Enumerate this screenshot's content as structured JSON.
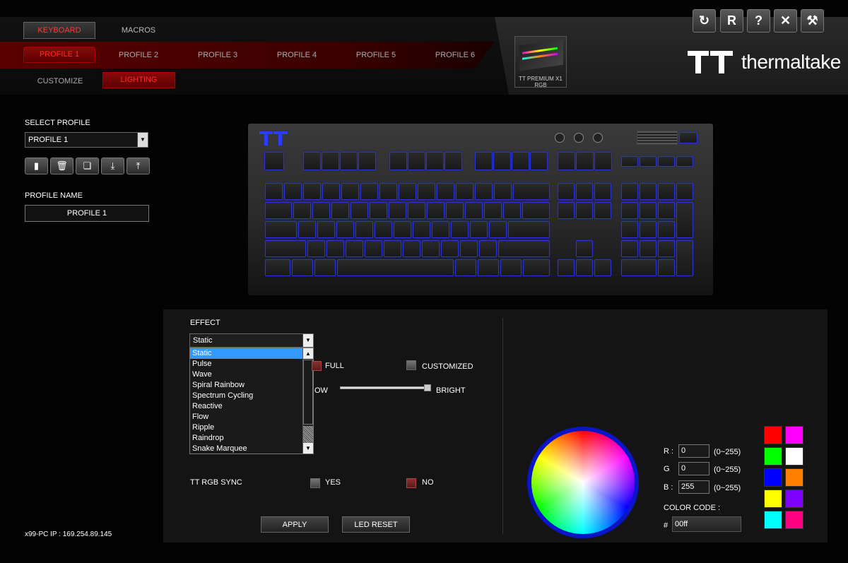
{
  "nav": {
    "keyboard_tab": "KEYBOARD",
    "macros_tab": "MACROS"
  },
  "profiles": [
    "PROFILE 1",
    "PROFILE 2",
    "PROFILE 3",
    "PROFILE 4",
    "PROFILE 5",
    "PROFILE 6"
  ],
  "subtabs": {
    "customize": "CUSTOMIZE",
    "lighting": "LIGHTING"
  },
  "device": {
    "name": "TT PREMIUM X1 RGB"
  },
  "brand": {
    "name": "thermaltake"
  },
  "toolbar": {
    "refresh_icon": "refresh-icon",
    "reset_label": "R",
    "help_label": "?",
    "close_label": "✕",
    "settings_icon": "wrench-icon"
  },
  "sidebar": {
    "select_profile_label": "SELECT PROFILE",
    "selected_profile": "PROFILE 1",
    "profile_name_label": "PROFILE NAME",
    "profile_name_value": "PROFILE 1",
    "ip_text": "x99-PC IP : 169.254.89.145"
  },
  "effect": {
    "label": "EFFECT",
    "selected": "Static",
    "options": [
      "Static",
      "Pulse",
      "Wave",
      "Spiral Rainbow",
      "Spectrum Cycling",
      "Reactive",
      "Flow",
      "Ripple",
      "Raindrop",
      "Snake Marquee"
    ],
    "full_label": "FULL",
    "customized_label": "CUSTOMIZED",
    "low_label": "OW",
    "bright_label": "BRIGHT",
    "brightness_level": 1.0
  },
  "sync": {
    "label": "TT RGB SYNC",
    "yes_label": "YES",
    "no_label": "NO"
  },
  "actions": {
    "apply": "APPLY",
    "led_reset": "LED RESET"
  },
  "color": {
    "r_label": "R :",
    "g_label": "G",
    "b_label": "B :",
    "r": "0",
    "g": "0",
    "b": "255",
    "range": "(0~255)",
    "code_label": "COLOR CODE :",
    "hash": "#",
    "code": "00ff",
    "swatches": [
      "#ff0000",
      "#ff00ff",
      "#00ff00",
      "#ffffff",
      "#0000ff",
      "#ff8000",
      "#ffff00",
      "#8000ff",
      "#00ffff",
      "#ff0080"
    ]
  }
}
